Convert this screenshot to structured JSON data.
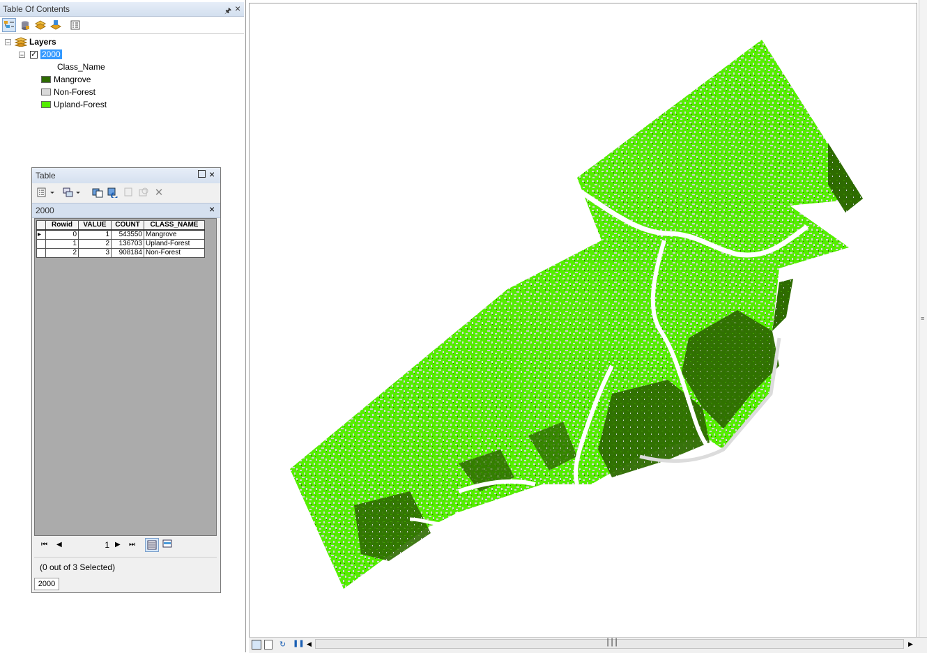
{
  "toc": {
    "title": "Table Of Contents",
    "pin_glyph": "↑",
    "close_glyph": "×",
    "tools": [
      "list-by-drawing-order-icon",
      "list-by-source-icon",
      "list-by-visibility-icon",
      "list-by-selection-icon",
      "options-icon"
    ],
    "root_label": "Layers",
    "layer_name": "2000",
    "layer_checked": true,
    "field_name": "Class_Name",
    "legend": [
      {
        "label": "Mangrove",
        "color": "#2e6b00"
      },
      {
        "label": "Non-Forest",
        "color": "#d9d9d9"
      },
      {
        "label": "Upland-Forest",
        "color": "#55ee00"
      }
    ]
  },
  "table_window": {
    "title": "Table",
    "tab_name": "2000",
    "columns": [
      "Rowid",
      "VALUE",
      "COUNT",
      "CLASS_NAME"
    ],
    "rows": [
      {
        "rowid": "0",
        "value": "1",
        "count": "543550",
        "class_name": "Mangrove"
      },
      {
        "rowid": "1",
        "value": "2",
        "count": "136703",
        "class_name": "Upland-Forest"
      },
      {
        "rowid": "2",
        "value": "3",
        "count": "908184",
        "class_name": "Non-Forest"
      }
    ],
    "current_record": "1",
    "selection_status": "(0 out of 3 Selected)",
    "bottom_tab": "2000"
  },
  "map": {
    "colors": {
      "mangrove": "#2e6b00",
      "upland": "#55ee00",
      "nonforest": "#dadada"
    }
  }
}
